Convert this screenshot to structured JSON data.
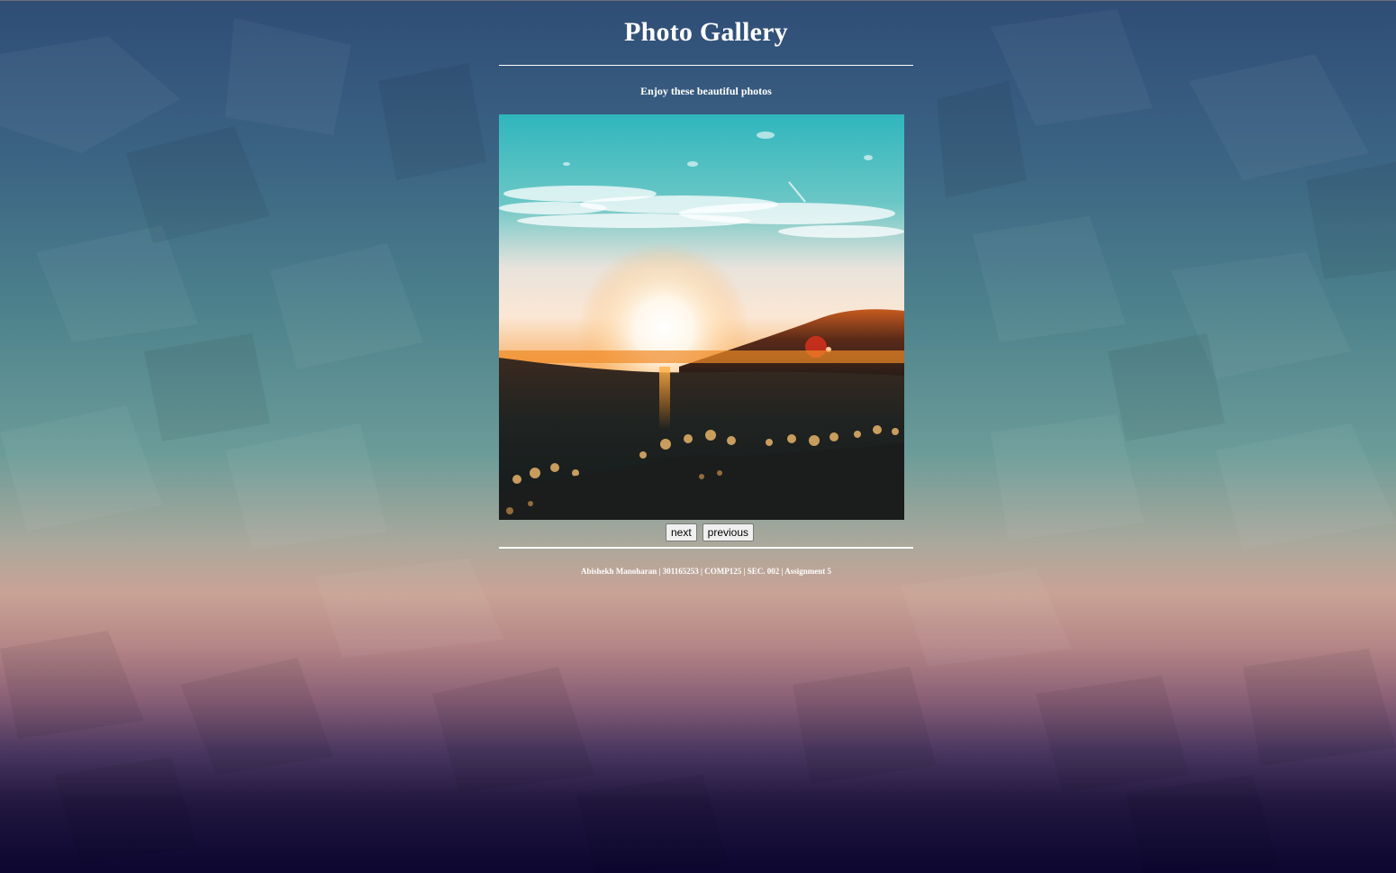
{
  "page": {
    "title": "Photo Gallery",
    "subtitle": "Enjoy these beautiful photos"
  },
  "gallery": {
    "current_photo": "sunset-over-hills",
    "next_label": "next",
    "previous_label": "previous"
  },
  "footer": {
    "text": "Abishekh Manoharan | 301165253 | COMP125 | SEC. 002 | Assignment 5"
  },
  "colors": {
    "text": "#ffffff",
    "background_top": "#2f4d76",
    "background_mid": "#6c9c99",
    "background_bottom": "#0c0630"
  }
}
